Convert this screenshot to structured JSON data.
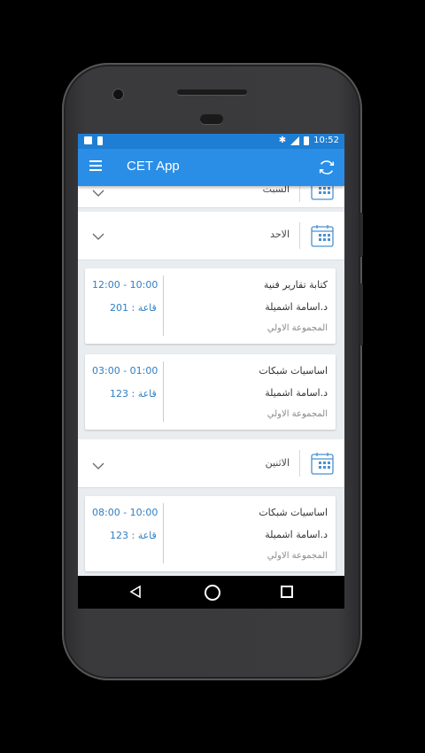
{
  "app": {
    "title": "CET App"
  },
  "status_bar": {
    "time": "10:52"
  },
  "days": [
    {
      "name": "السبت"
    },
    {
      "name": "الاحد"
    },
    {
      "name": "الاثنين"
    }
  ],
  "lectures": [
    {
      "time": "12:00 - 10:00",
      "room": "قاعة : 201",
      "course": "كتابة تقارير فنية",
      "teacher": "د.اسامة اشميلة",
      "group": "المجموعة الاولي"
    },
    {
      "time": "03:00 - 01:00",
      "room": "قاعة : 123",
      "course": "اساسيات شبكات",
      "teacher": "د.اسامة اشميلة",
      "group": "المجموعة الاولي"
    },
    {
      "time": "08:00 - 10:00",
      "room": "قاعة : 123",
      "course": "اساسيات شبكات",
      "teacher": "د.اسامة اشميلة",
      "group": "المجموعة الاولي"
    }
  ],
  "colors": {
    "status_bar": "#1e7ed4",
    "app_bar": "#2a8ee6",
    "accent": "#2f7ec5",
    "background": "#e9edf0"
  },
  "icons": {
    "menu": "hamburger-icon",
    "refresh": "refresh-icon",
    "calendar": "calendar-icon",
    "expand": "chevron-down-icon"
  }
}
